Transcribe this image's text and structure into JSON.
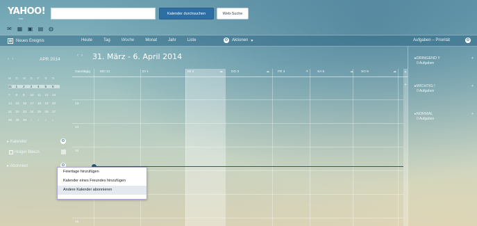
{
  "header": {
    "logo": "YAHOO!",
    "logo_sub": "MAIL",
    "search_placeholder": "",
    "search_button": "Kalender durchsuchen",
    "web_button": "Web-Suche",
    "app_icons": [
      "mail-icon",
      "calendar-icon",
      "contacts-icon",
      "notepad-icon",
      "messenger-icon"
    ]
  },
  "toolbar": {
    "new_event": "Neues Ereignis",
    "views": [
      "Heute",
      "Tag",
      "Woche",
      "Monat",
      "Jahr",
      "Liste"
    ],
    "active_view": "Woche",
    "actions": "Aktionen",
    "tasks_title": "Aufgaben – Priorität"
  },
  "sidebar": {
    "nav_prev": "‹",
    "nav_next": "›",
    "month": "APR 2014",
    "weekday_headers": [
      "M",
      "D",
      "M",
      "D",
      "F",
      "S",
      "S"
    ],
    "weeks": [
      [
        "31",
        "1",
        "2",
        "3",
        "4",
        "5",
        "6"
      ],
      [
        "7",
        "8",
        "9",
        "10",
        "11",
        "12",
        "13"
      ],
      [
        "14",
        "15",
        "16",
        "17",
        "18",
        "19",
        "20"
      ],
      [
        "21",
        "22",
        "23",
        "24",
        "25",
        "26",
        "27"
      ],
      [
        "28",
        "29",
        "30",
        "1",
        "2",
        "3",
        "4"
      ]
    ],
    "calendars_label": "Kalender",
    "calendar_item": "Holger Bleich",
    "subscribed_label": "Abonniert"
  },
  "calendar": {
    "nav_prev": "‹",
    "nav_next": "›",
    "range": "31. März - 6. April 2014",
    "allday_label": "Ganztägig",
    "days": [
      "MO 31",
      "DI 1",
      "MI 2",
      "DO 3",
      "FR 4",
      "SA 5",
      "SO 6"
    ],
    "hours": [
      "13",
      "14",
      "15",
      "16"
    ]
  },
  "tasks": [
    {
      "title": "DRINGEND !!",
      "count": "0 Aufgaben"
    },
    {
      "title": "WICHTIG !",
      "count": "0 Aufgaben"
    },
    {
      "title": "NORMAL",
      "count": "0 Aufgaben"
    }
  ],
  "context_menu": {
    "items": [
      "Feiertage hinzufügen",
      "Kalender eines Freundes hinzufügen",
      "Andere Kalender abonnieren"
    ],
    "highlighted": "Andere Kalender abonnieren"
  }
}
